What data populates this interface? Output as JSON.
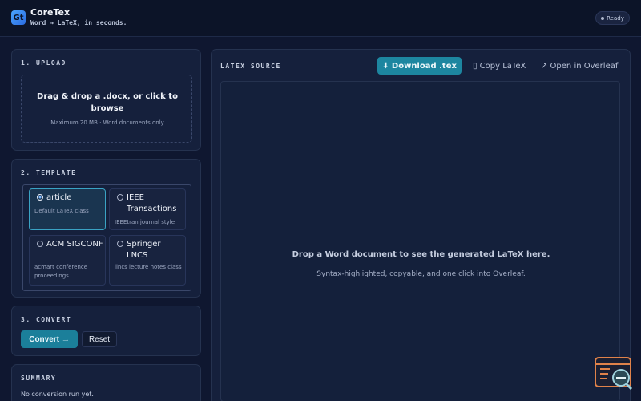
{
  "app": {
    "logo_glyph": "Gt",
    "title": "CoreTex",
    "subtitle": "Word → LaTeX, in seconds.",
    "status": "Ready"
  },
  "upload": {
    "title": "1. UPLOAD",
    "drop_text": "Drag & drop a .docx, or click to browse",
    "note": "Maximum 20 MB · Word documents only"
  },
  "template": {
    "title": "2. TEMPLATE",
    "options": [
      {
        "name": "article",
        "desc": "Default LaTeX class",
        "selected": true
      },
      {
        "name": "IEEE Transactions",
        "desc": "IEEEtran journal style",
        "selected": false
      },
      {
        "name": "ACM SIGCONF",
        "desc": "acmart conference proceedings",
        "selected": false
      },
      {
        "name": "Springer LNCS",
        "desc": "llncs lecture notes class",
        "selected": false
      }
    ]
  },
  "convert": {
    "title": "3. CONVERT",
    "convert_label": "Convert →",
    "reset_label": "Reset"
  },
  "summary": {
    "title": "SUMMARY",
    "text": "No conversion run yet."
  },
  "latex": {
    "title": "LATEX SOURCE",
    "download_label": "⬇ Download .tex",
    "copy_label": "▯ Copy LaTeX",
    "overleaf_label": "↗ Open in Overleaf",
    "empty_main": "Drop a Word document to see the generated LaTeX here.",
    "empty_sub": "Syntax-highlighted, copyable, and one click into Overleaf."
  },
  "colors": {
    "accent": "#1d86a0",
    "background": "#0f1730",
    "card": "#15203c",
    "widget": "#e0824a"
  },
  "icons": {
    "download": "download-icon",
    "copy": "copy-icon",
    "external": "external-link-icon",
    "widget": "code-search-icon"
  }
}
